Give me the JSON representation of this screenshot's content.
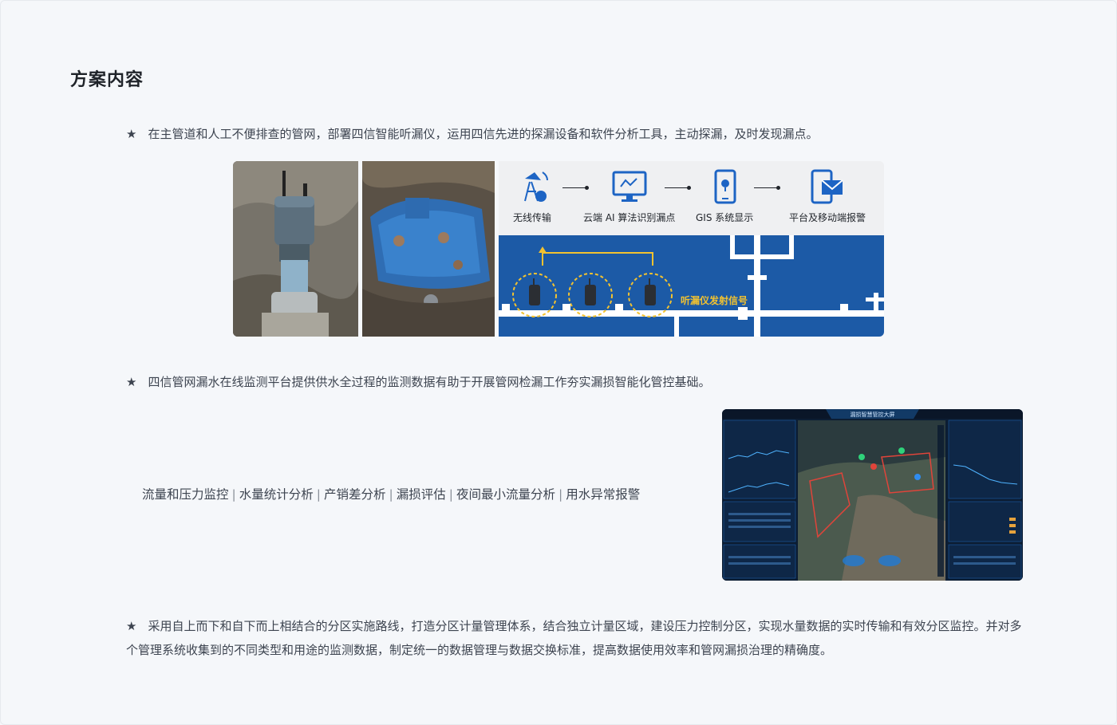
{
  "section": {
    "title": "方案内容"
  },
  "paragraphs": {
    "p1": "在主管道和人工不便排查的管网，部署四信智能听漏仪，运用四信先进的探漏设备和软件分析工具，主动探漏，及时发现漏点。",
    "p2": "四信管网漏水在线监测平台提供供水全过程的监测数据有助于开展管网检漏工作夯实漏损智能化管控基础。",
    "p3": "采用自上而下和自下而上相结合的分区实施路线，打造分区计量管理体系，结合独立计量区域，建设压力控制分区，实现水量数据的实时传输和有效分区监控。并对多个管理系统收集到的不同类型和用途的监测数据，制定统一的数据管理与数据交换标准，提高数据使用效率和管网漏损治理的精确度。"
  },
  "star": "★",
  "features": [
    "流量和压力监控",
    "水量统计分析",
    "产销差分析",
    "漏损评估",
    "夜间最小流量分析",
    "用水异常报警"
  ],
  "feature_separator": "|",
  "diagram": {
    "steps": [
      "无线传输",
      "云端 AI 算法识别漏点",
      "GIS 系统显示",
      "平台及移动端报警"
    ],
    "signal_label": "听漏仪发射信号"
  },
  "dashboard": {
    "title": "漏损智慧管控大屏",
    "date_labels": [
      "2025-02-14",
      "2025-02-1"
    ],
    "axis_labels": [
      "02/11",
      "02/12",
      "02/13",
      "02/14",
      "02/16"
    ]
  },
  "colors": {
    "background": "#f5f7fa",
    "text": "#3d4450",
    "title": "#1f2329",
    "diagram_blue": "#1c5aa6",
    "signal_yellow": "#f2c230",
    "icon_blue": "#1d64c4"
  }
}
